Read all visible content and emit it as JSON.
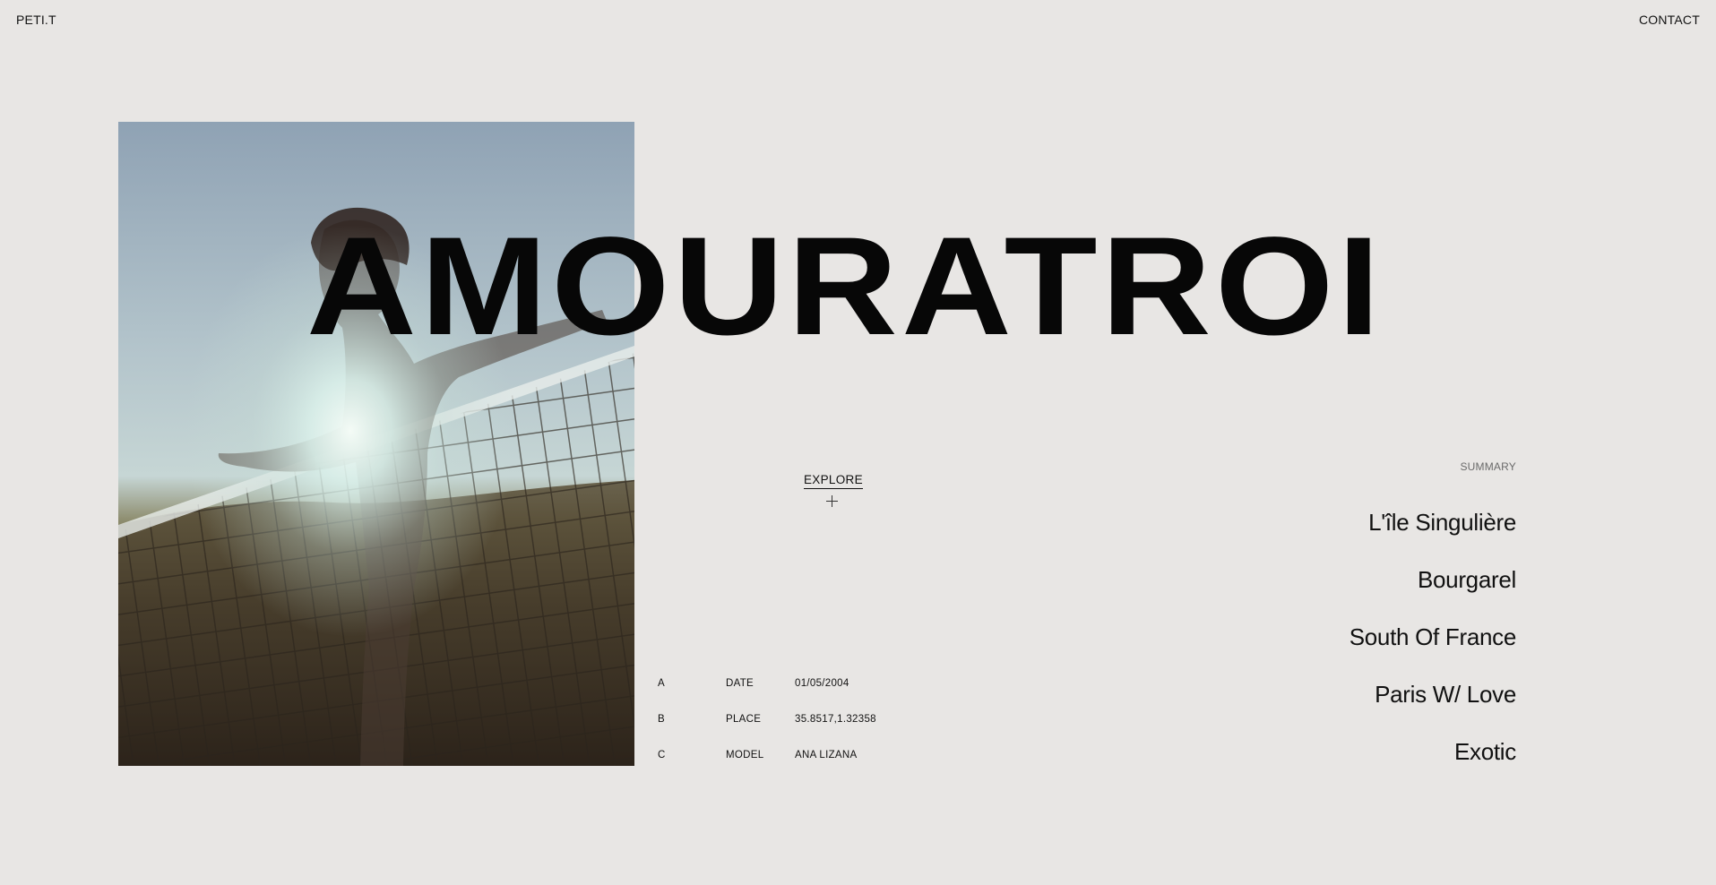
{
  "header": {
    "brand": "PETI.T",
    "contact_label": "CONTACT"
  },
  "hero": {
    "title": "AMOURATROI",
    "photo_icon": "photo-icon"
  },
  "explore": {
    "label": "EXPLORE",
    "icon": "plus-icon"
  },
  "details": [
    {
      "key": "A",
      "label": "DATE",
      "value": "01/05/2004"
    },
    {
      "key": "B",
      "label": "PLACE",
      "value": "35.8517,1.32358"
    },
    {
      "key": "C",
      "label": "MODEL",
      "value": "ANA LIZANA"
    }
  ],
  "summary": {
    "label": "SUMMARY",
    "items": [
      "L'île Singulière",
      "Bourgarel",
      "South Of France",
      "Paris W/ Love",
      "Exotic"
    ]
  },
  "colors": {
    "background": "#e8e6e4",
    "text": "#0e0e0e",
    "muted": "#6a6a6a"
  }
}
